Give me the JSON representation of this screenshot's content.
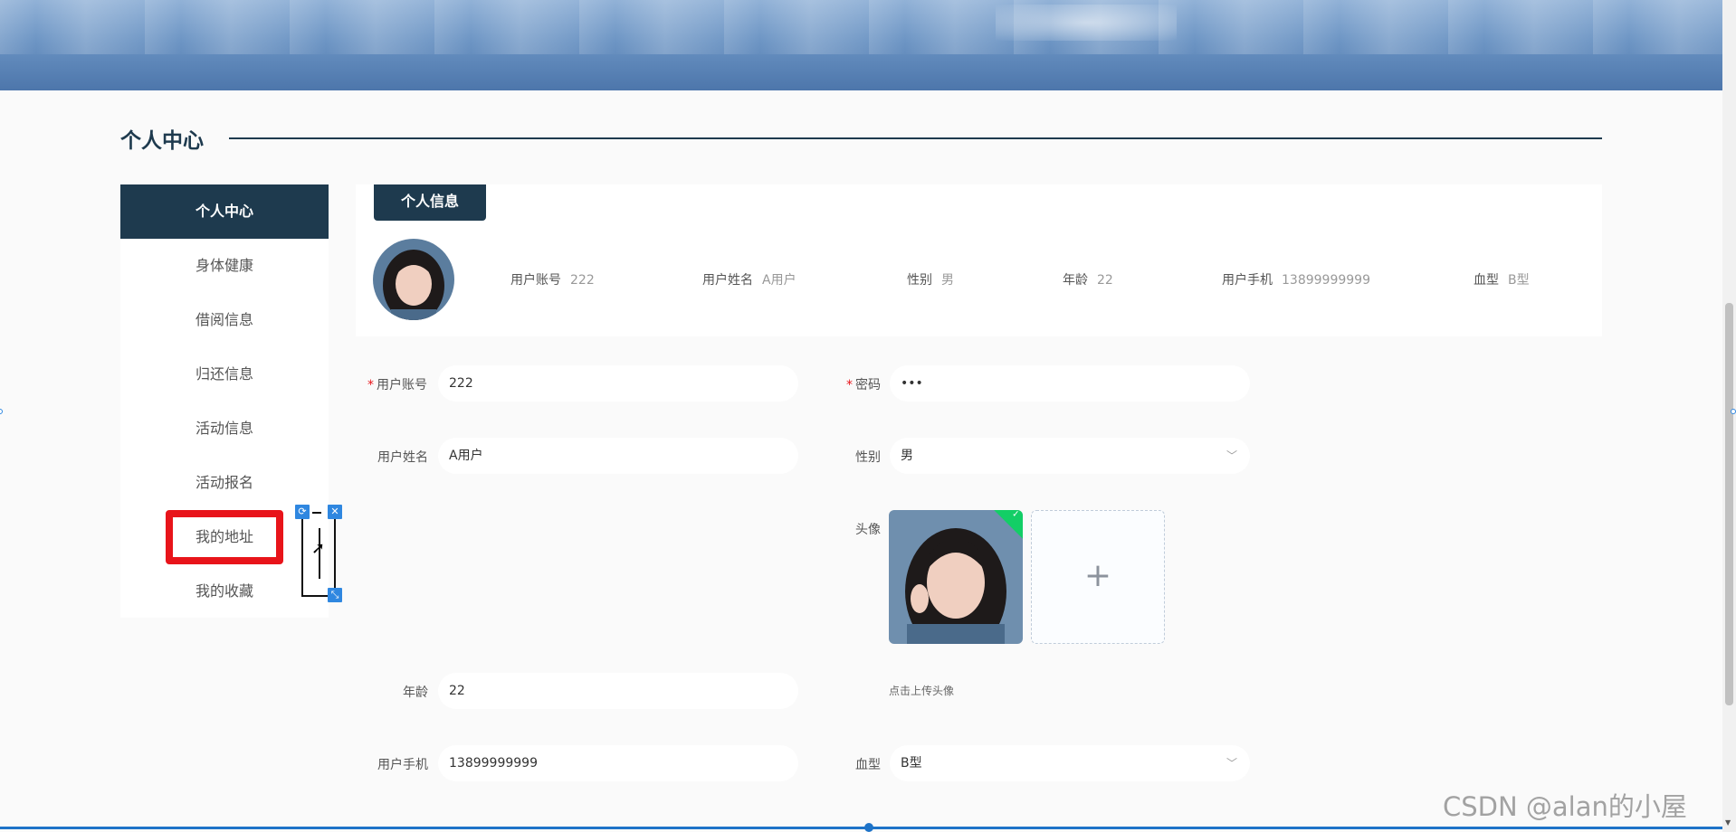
{
  "page": {
    "section_title": "个人中心",
    "watermark": "CSDN @alan的小屋"
  },
  "sidebar": {
    "items": [
      {
        "label": "个人中心",
        "active": true
      },
      {
        "label": "身体健康"
      },
      {
        "label": "借阅信息"
      },
      {
        "label": "归还信息"
      },
      {
        "label": "活动信息"
      },
      {
        "label": "活动报名"
      },
      {
        "label": "我的地址",
        "highlighted": true
      },
      {
        "label": "我的收藏"
      }
    ]
  },
  "info_card": {
    "tab_label": "个人信息",
    "fields": [
      {
        "label": "用户账号",
        "value": "222"
      },
      {
        "label": "用户姓名",
        "value": "A用户"
      },
      {
        "label": "性别",
        "value": "男"
      },
      {
        "label": "年龄",
        "value": "22"
      },
      {
        "label": "用户手机",
        "value": "13899999999"
      },
      {
        "label": "血型",
        "value": "B型"
      }
    ]
  },
  "form": {
    "account": {
      "label": "用户账号",
      "value": "222",
      "required": true
    },
    "password": {
      "label": "密码",
      "value": "•••",
      "required": true
    },
    "name": {
      "label": "用户姓名",
      "value": "A用户"
    },
    "gender": {
      "label": "性别",
      "value": "男"
    },
    "avatar": {
      "label": "头像",
      "tip": "点击上传头像"
    },
    "age": {
      "label": "年龄",
      "value": "22"
    },
    "phone": {
      "label": "用户手机",
      "value": "13899999999"
    },
    "blood": {
      "label": "血型",
      "value": "B型"
    }
  },
  "colors": {
    "primary": "#1e3a4e",
    "highlight": "#e8141a",
    "success": "#13ce66",
    "widget": "#2f87e0"
  }
}
